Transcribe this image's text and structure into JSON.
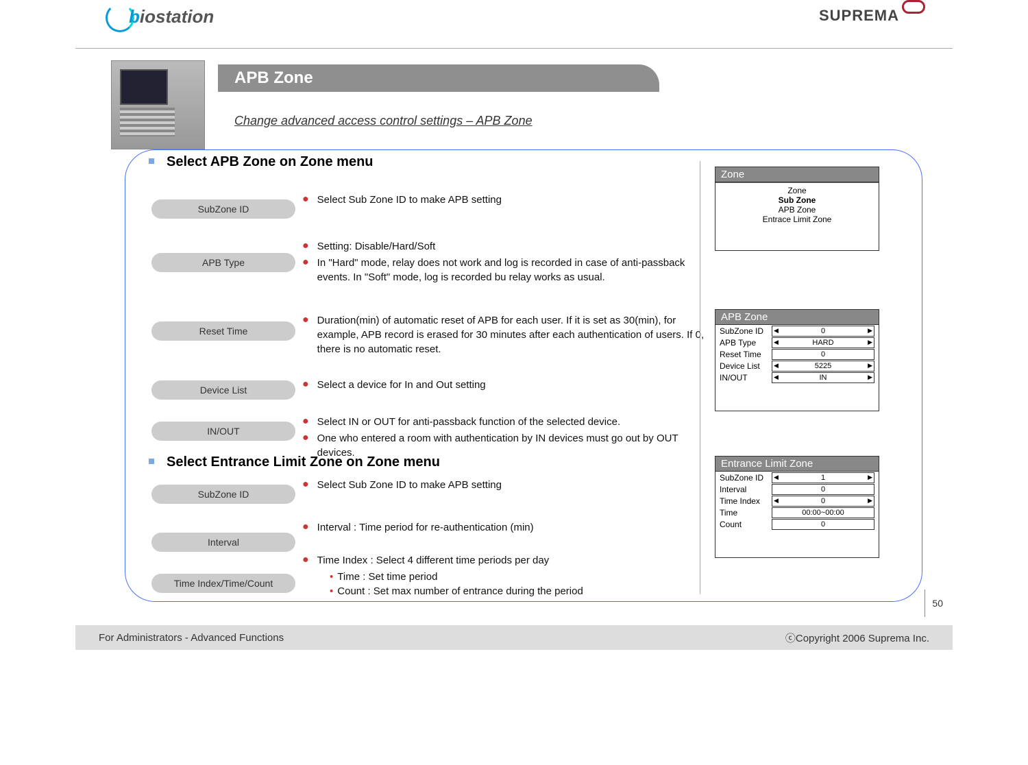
{
  "header": {
    "logo_left_b": "b",
    "logo_left_io": "iostation",
    "logo_right": "SUPREMA"
  },
  "title": "APB Zone",
  "subtitle": "Change advanced access control settings – APB Zone",
  "pagenum": "50",
  "footer": {
    "left": "For Administrators - Advanced Functions",
    "right": "ⓒCopyright 2006 Suprema Inc."
  },
  "section1": {
    "heading": "Select APB Zone on Zone menu",
    "items": [
      {
        "label": "SubZone ID",
        "bullets": [
          "Select Sub Zone ID to make APB setting"
        ]
      },
      {
        "label": "APB Type",
        "bullets": [
          "Setting: Disable/Hard/Soft",
          "In \"Hard\" mode, relay does not work and log is recorded in case of anti-passback events. In \"Soft\" mode, log is recorded bu relay works as usual."
        ]
      },
      {
        "label": "Reset Time",
        "bullets": [
          "Duration(min) of automatic reset of APB for each user. If it is set as 30(min), for example, APB record is erased for 30 minutes after each authentication of users. If 0, there is no automatic reset."
        ]
      },
      {
        "label": "Device List",
        "bullets": [
          "Select a device for In and Out setting"
        ]
      },
      {
        "label": "IN/OUT",
        "bullets": [
          "Select IN or OUT for anti-passback function of the selected device.",
          "One who entered a room with authentication by IN devices must go out by OUT devices."
        ]
      }
    ]
  },
  "section2": {
    "heading": "Select Entrance Limit Zone on Zone menu",
    "items": [
      {
        "label": "SubZone ID",
        "bullets": [
          "Select Sub Zone ID to make APB setting"
        ]
      },
      {
        "label": "Interval",
        "bullets": [
          "Interval : Time period for re-authentication (min)"
        ]
      },
      {
        "label": "Time Index/Time/Count",
        "bullets": [
          "Time Index : Select 4 different time periods per day"
        ],
        "subs": [
          "Time : Set time period",
          "Count : Set max number of entrance during the period"
        ]
      }
    ]
  },
  "screens": {
    "zone": {
      "title": "Zone",
      "lines": [
        "Zone",
        "Sub Zone",
        "APB Zone",
        "Entrace Limit Zone"
      ],
      "bold_idx": 1
    },
    "apb": {
      "title": "APB Zone",
      "rows": [
        {
          "lab": "SubZone ID",
          "val": "0",
          "arrows": true
        },
        {
          "lab": "APB Type",
          "val": "HARD",
          "arrows": true
        },
        {
          "lab": "Reset Time",
          "val": "0",
          "arrows": false
        },
        {
          "lab": "Device List",
          "val": "5225",
          "arrows": true
        },
        {
          "lab": "IN/OUT",
          "val": "IN",
          "arrows": true
        }
      ]
    },
    "elz": {
      "title": "Entrance Limit Zone",
      "rows": [
        {
          "lab": "SubZone ID",
          "val": "1",
          "arrows": true
        },
        {
          "lab": "Interval",
          "val": "0",
          "arrows": false
        },
        {
          "lab": "Time Index",
          "val": "0",
          "arrows": true
        },
        {
          "lab": "Time",
          "val": "00:00~00:00",
          "arrows": false
        },
        {
          "lab": "Count",
          "val": "0",
          "arrows": false
        }
      ]
    }
  }
}
